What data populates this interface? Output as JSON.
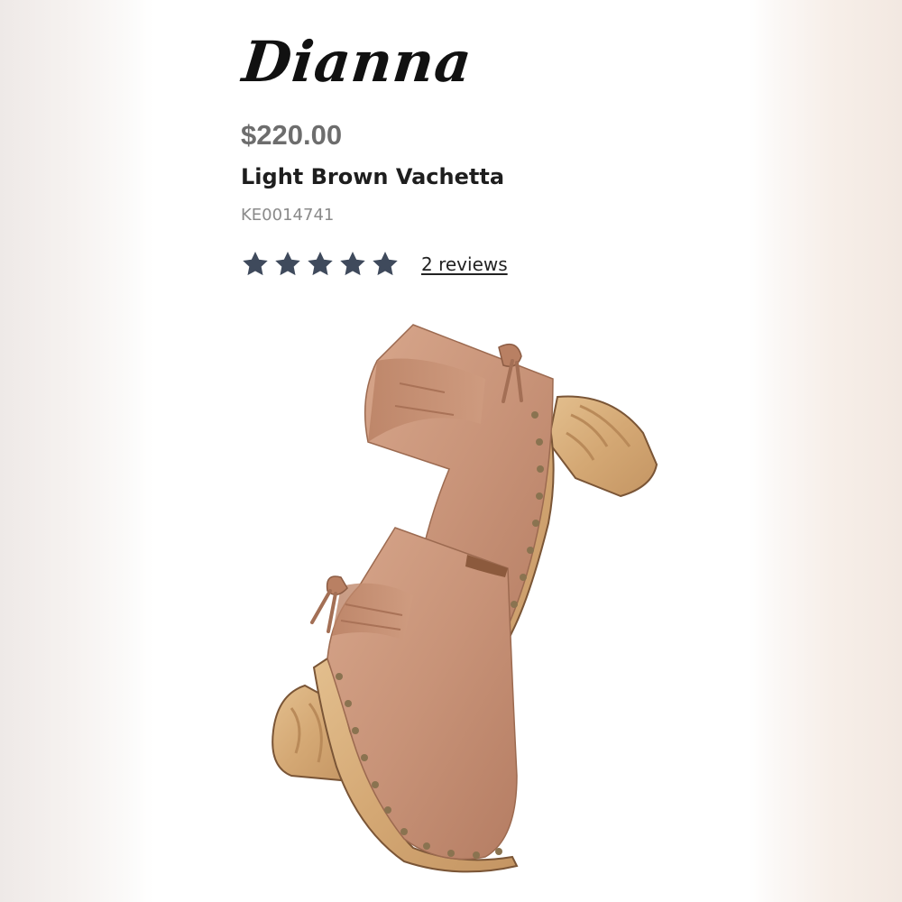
{
  "product": {
    "name": "Dianna",
    "price": "$220.00",
    "color_name": "Light Brown Vachetta",
    "sku": "KE0014741",
    "rating": {
      "stars_filled": 5,
      "stars_total": 5,
      "star_color": "#3f4a5c",
      "reviews_label": "2 reviews"
    },
    "image": {
      "icon": "ankle-boots-photo",
      "leather_color": "#c89378",
      "heel_color": "#d9b07e",
      "stud_color": "#8a7350"
    }
  }
}
